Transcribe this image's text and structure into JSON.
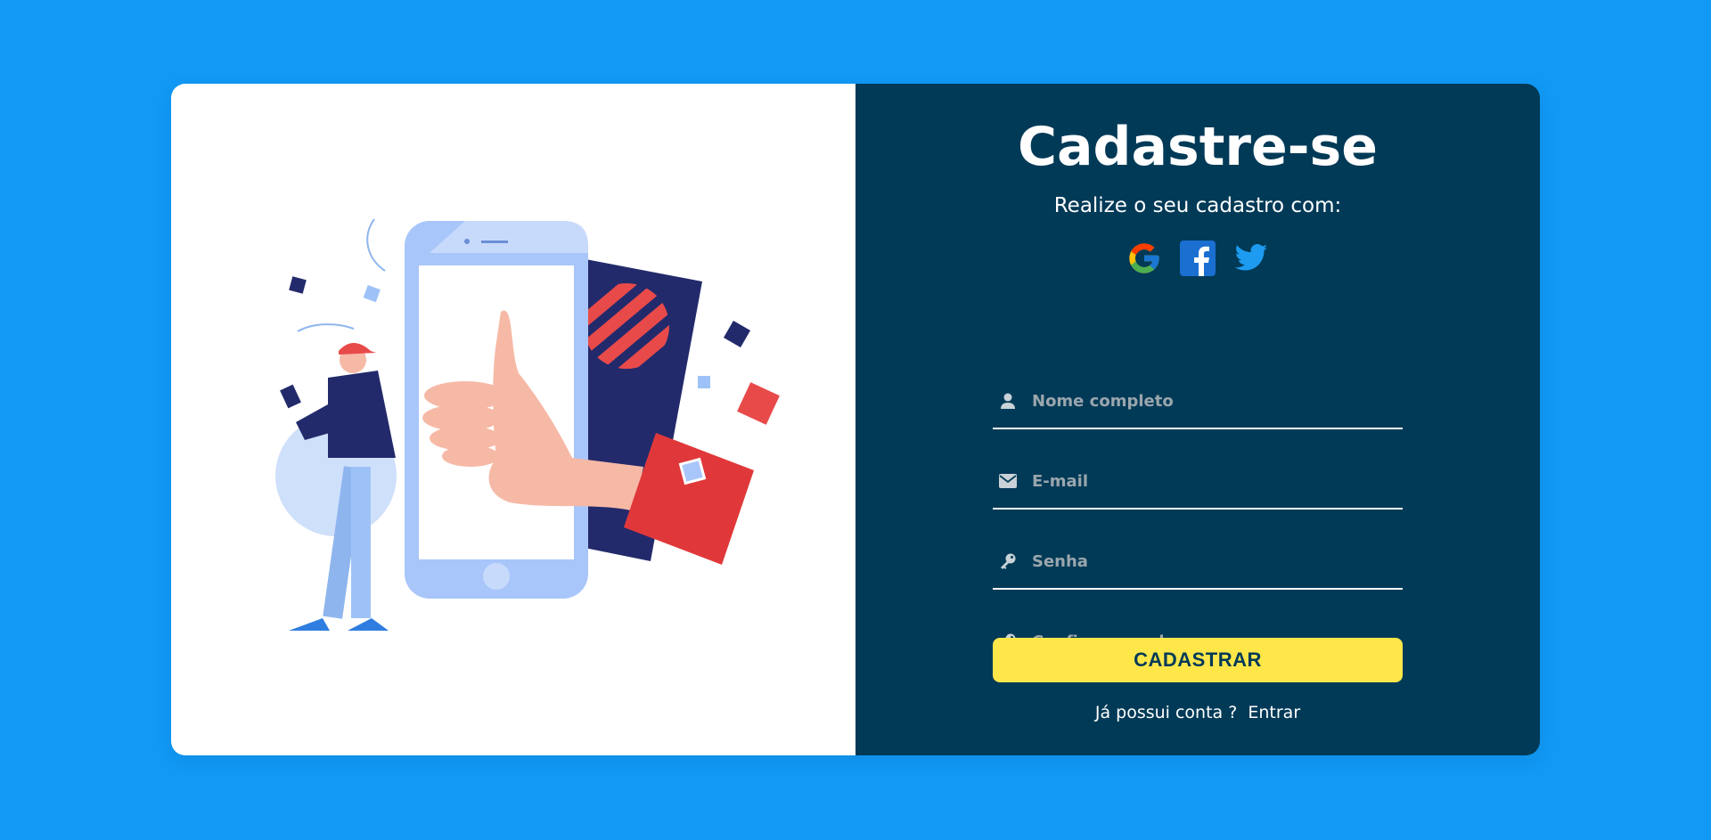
{
  "form": {
    "title": "Cadastre-se",
    "subtitle": "Realize o seu cadastro com:",
    "social": [
      {
        "icon": "google-icon"
      },
      {
        "icon": "facebook-icon"
      },
      {
        "icon": "twitter-icon"
      }
    ],
    "fields": {
      "name_placeholder": "Nome completo",
      "email_placeholder": "E-mail",
      "password_placeholder": "Senha",
      "confirm_placeholder": "Confirmar senha"
    },
    "submit_label": "CADASTRAR",
    "login_prompt": "Já possui conta ?",
    "login_link": "Entrar"
  },
  "colors": {
    "background": "#1199f5",
    "panel": "#003a57",
    "button": "#ffe74a",
    "button_text": "#003a57"
  }
}
